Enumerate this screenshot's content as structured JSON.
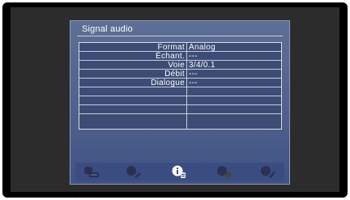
{
  "menu": {
    "title": "Signal audio"
  },
  "info_rows": [
    {
      "label": "Format",
      "value": "Analog"
    },
    {
      "label": "Échant.",
      "value": "---"
    },
    {
      "label": "Voie",
      "value": "3/4/0.1"
    },
    {
      "label": "Débit",
      "value": "---"
    },
    {
      "label": "Dialogue",
      "value": "---"
    },
    {
      "label": "",
      "value": ""
    },
    {
      "label": "",
      "value": ""
    },
    {
      "label": "",
      "value": ""
    },
    {
      "label": "",
      "value": ""
    }
  ],
  "icon_bar": [
    {
      "name": "video-signal-icon",
      "active": false
    },
    {
      "name": "setup-icon",
      "active": false
    },
    {
      "name": "info-icon",
      "active": true
    },
    {
      "name": "audio-icon",
      "active": false
    },
    {
      "name": "settings-icon",
      "active": false
    }
  ],
  "colors": {
    "panel": "#4c5e8a",
    "grid": "#3c4c75",
    "icon_bar": "#3a4c80"
  }
}
